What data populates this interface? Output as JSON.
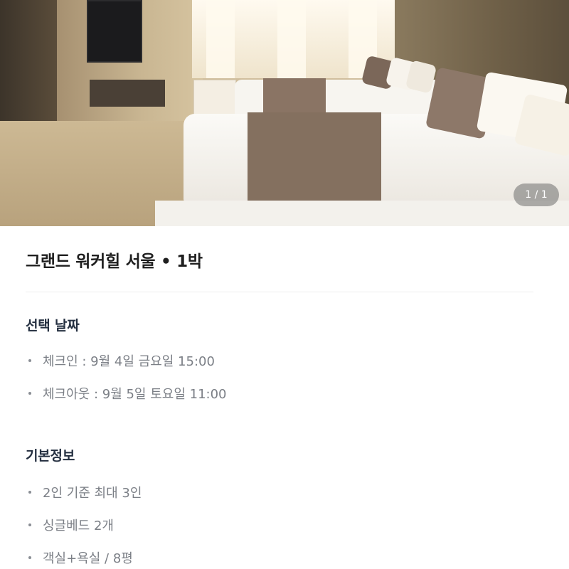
{
  "gallery": {
    "indicator": "1 / 1"
  },
  "hotel": {
    "title": "그랜드 워커힐 서울 • 1박"
  },
  "selected_dates": {
    "heading": "선택 날짜",
    "items": [
      "체크인 : 9월 4일 금요일 15:00",
      "체크아웃 : 9월 5일 토요일 11:00"
    ]
  },
  "basic_info": {
    "heading": "기본정보",
    "items": [
      "2인 기준 최대 3인",
      "싱글베드 2개",
      "객실+욕실 / 8평"
    ]
  }
}
